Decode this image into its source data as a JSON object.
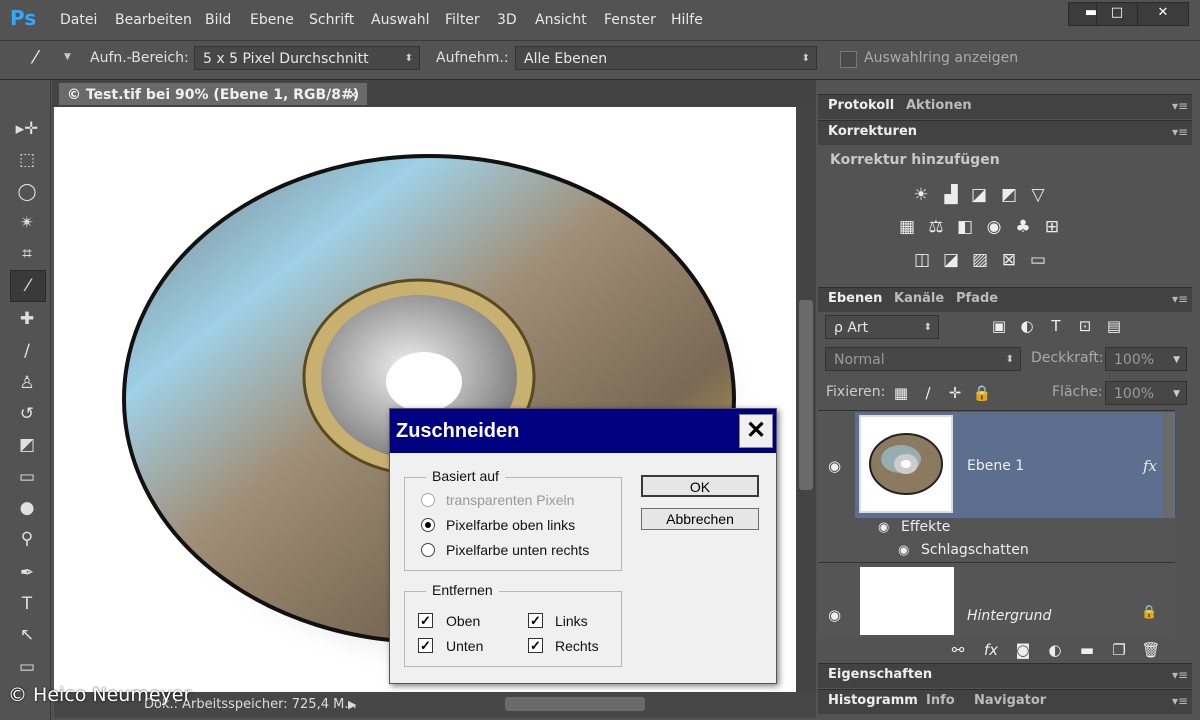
{
  "app": {
    "logo": "Ps"
  },
  "menu": [
    "Datei",
    "Bearbeiten",
    "Bild",
    "Ebene",
    "Schrift",
    "Auswahl",
    "Filter",
    "3D",
    "Ansicht",
    "Fenster",
    "Hilfe"
  ],
  "window_controls": {
    "minimize": "▬",
    "maximize": "□",
    "close": "✕"
  },
  "options": {
    "sample_area_label": "Aufn.-Bereich:",
    "sample_area_value": "5 x 5 Pixel Durchschnitt",
    "sample_label": "Aufnehm.:",
    "sample_value": "Alle Ebenen",
    "show_ring_label": "Auswahlring anzeigen"
  },
  "document": {
    "tab_title": "© Test.tif bei 90% (Ebene 1, RGB/8#)",
    "close": "×",
    "status": "Dok.: Arbeitsspeicher: 725,4 M...",
    "status_arrow": "▶",
    "copyright": "© Heico Neumeyer"
  },
  "panels": {
    "history_tabs": [
      "Protokoll",
      "Aktionen"
    ],
    "corrections_tab": "Korrekturen",
    "add_correction": "Korrektur hinzufügen",
    "layers_tabs": [
      "Ebenen",
      "Kanäle",
      "Pfade"
    ],
    "filter_kind": "ρ Art",
    "blend_mode": "Normal",
    "opacity_label": "Deckkraft:",
    "opacity_value": "100%",
    "lock_label": "Fixieren:",
    "fill_label": "Fläche:",
    "fill_value": "100%",
    "properties_tab": "Eigenschaften",
    "bottom_tabs": [
      "Histogramm",
      "Info",
      "Navigator"
    ]
  },
  "layers": [
    {
      "name": "Ebene 1",
      "fx": "fx",
      "effects_label": "Effekte",
      "effect": "Schlagschatten"
    },
    {
      "name": "Hintergrund"
    }
  ],
  "dialog": {
    "title": "Zuschneiden",
    "close": "✕",
    "group1_title": "Basiert auf",
    "radios": [
      {
        "label": "transparenten Pixeln",
        "disabled": true,
        "selected": false
      },
      {
        "label": "Pixelfarbe oben links",
        "disabled": false,
        "selected": true
      },
      {
        "label": "Pixelfarbe unten rechts",
        "disabled": false,
        "selected": false
      }
    ],
    "group2_title": "Entfernen",
    "checks": {
      "top": "Oben",
      "bottom": "Unten",
      "left": "Links",
      "right": "Rechts"
    },
    "ok": "OK",
    "cancel": "Abbrechen"
  },
  "colors": {
    "accent": "#2fa8ff",
    "dialog_title": "#000080",
    "layer_selected": "#5d6f8f"
  }
}
